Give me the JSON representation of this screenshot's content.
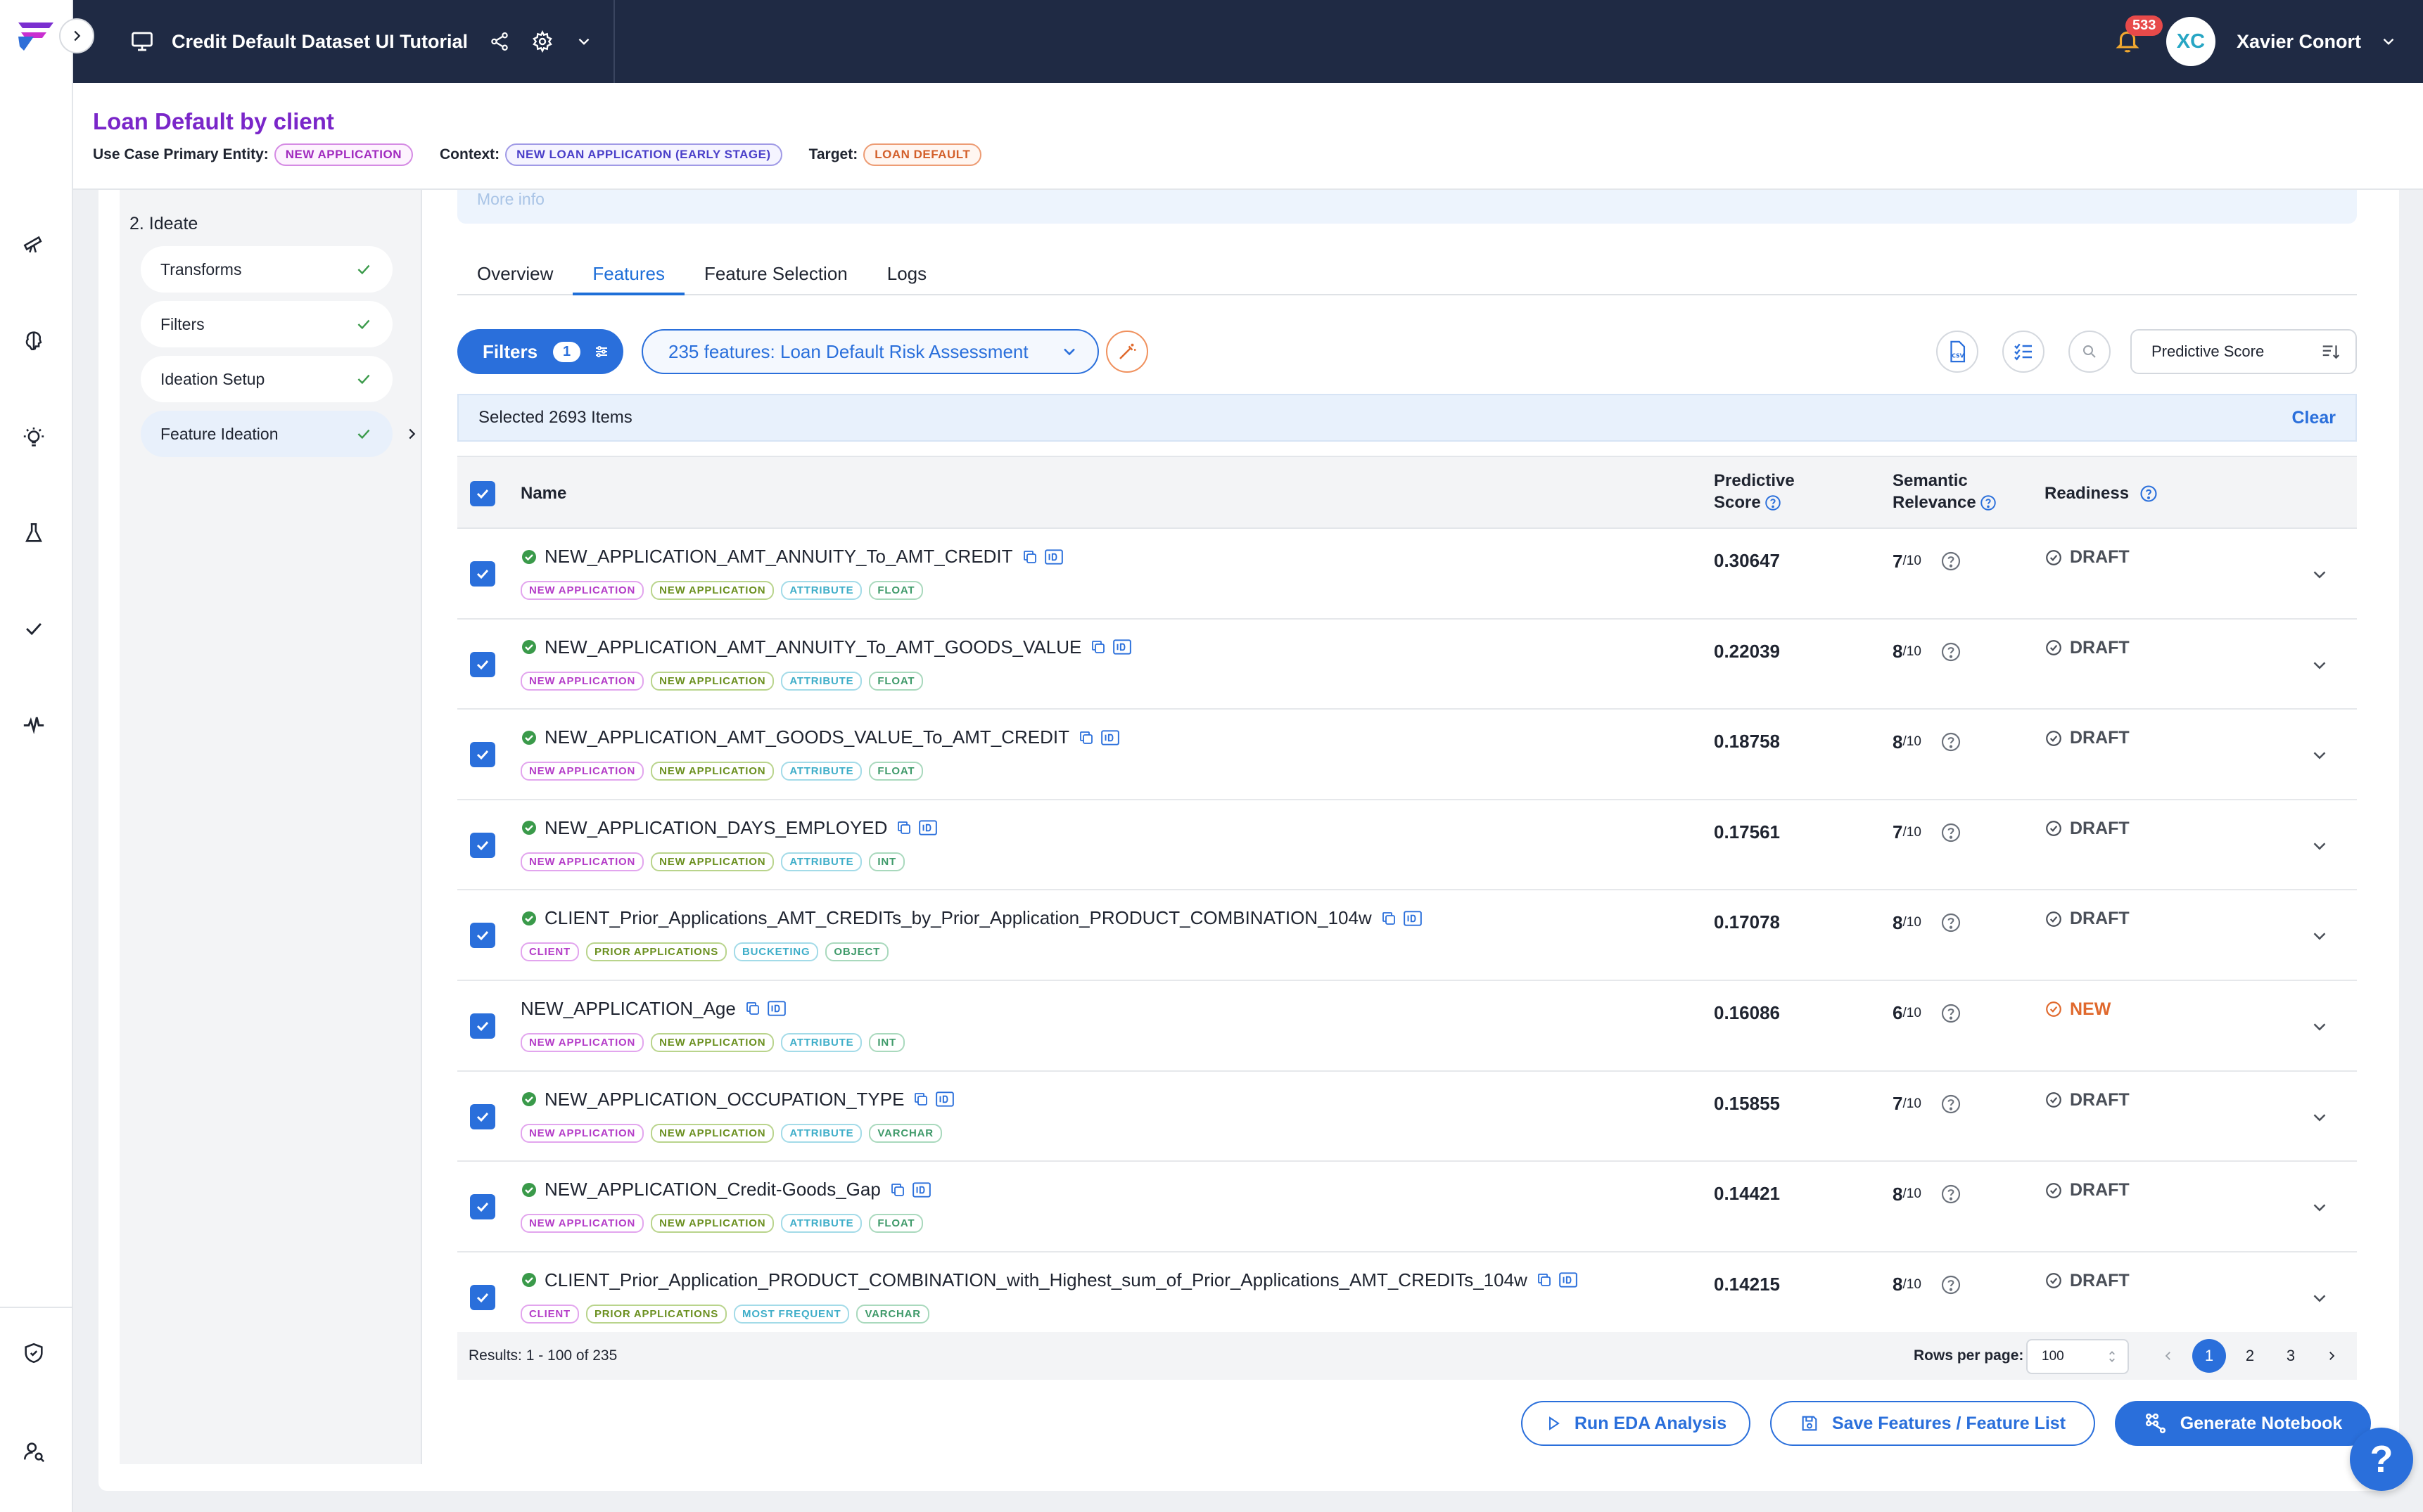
{
  "app": {
    "project_title": "Credit Default Dataset UI Tutorial",
    "notifications_count": "533",
    "user_initials": "XC",
    "user_name": "Xavier Conort"
  },
  "use_case": {
    "title": "Loan Default by client",
    "primary_entity_label": "Use Case Primary Entity:",
    "primary_entity": "NEW APPLICATION",
    "context_label": "Context:",
    "context": "NEW LOAN APPLICATION (EARLY STAGE)",
    "target_label": "Target:",
    "target": "LOAN DEFAULT"
  },
  "sidebar": {
    "section_title": "2. Ideate",
    "steps": [
      {
        "label": "Transforms"
      },
      {
        "label": "Filters"
      },
      {
        "label": "Ideation Setup"
      },
      {
        "label": "Feature Ideation"
      }
    ]
  },
  "banner": {
    "text": "More info"
  },
  "tabs": [
    {
      "label": "Overview"
    },
    {
      "label": "Features"
    },
    {
      "label": "Feature Selection"
    },
    {
      "label": "Logs"
    }
  ],
  "toolbar": {
    "filters_label": "Filters",
    "filters_count": "1",
    "features_selector": "235 features: Loan Default Risk Assessment",
    "sort_by": "Predictive Score"
  },
  "selection": {
    "text": "Selected 2693 Items",
    "clear_label": "Clear"
  },
  "table": {
    "headers": {
      "name": "Name",
      "predictive_score_line1": "Predictive",
      "predictive_score_line2": "Score",
      "semantic_relevance_line1": "Semantic",
      "semantic_relevance_line2": "Relevance",
      "readiness": "Readiness"
    },
    "rows": [
      {
        "name": "NEW_APPLICATION_AMT_ANNUITY_To_AMT_CREDIT",
        "tags": [
          "NEW APPLICATION",
          "NEW APPLICATION",
          "ATTRIBUTE",
          "FLOAT"
        ],
        "score": "0.30647",
        "relevance": "7",
        "relevance_suffix": "/10",
        "readiness": "DRAFT"
      },
      {
        "name": "NEW_APPLICATION_AMT_ANNUITY_To_AMT_GOODS_VALUE",
        "tags": [
          "NEW APPLICATION",
          "NEW APPLICATION",
          "ATTRIBUTE",
          "FLOAT"
        ],
        "score": "0.22039",
        "relevance": "8",
        "relevance_suffix": "/10",
        "readiness": "DRAFT"
      },
      {
        "name": "NEW_APPLICATION_AMT_GOODS_VALUE_To_AMT_CREDIT",
        "tags": [
          "NEW APPLICATION",
          "NEW APPLICATION",
          "ATTRIBUTE",
          "FLOAT"
        ],
        "score": "0.18758",
        "relevance": "8",
        "relevance_suffix": "/10",
        "readiness": "DRAFT"
      },
      {
        "name": "NEW_APPLICATION_DAYS_EMPLOYED",
        "tags": [
          "NEW APPLICATION",
          "NEW APPLICATION",
          "ATTRIBUTE",
          "INT"
        ],
        "score": "0.17561",
        "relevance": "7",
        "relevance_suffix": "/10",
        "readiness": "DRAFT"
      },
      {
        "name": "CLIENT_Prior_Applications_AMT_CREDITs_by_Prior_Application_PRODUCT_COMBINATION_104w",
        "tags": [
          "CLIENT",
          "PRIOR APPLICATIONS",
          "BUCKETING",
          "OBJECT"
        ],
        "score": "0.17078",
        "relevance": "8",
        "relevance_suffix": "/10",
        "readiness": "DRAFT"
      },
      {
        "name": "NEW_APPLICATION_Age",
        "tags": [
          "NEW APPLICATION",
          "NEW APPLICATION",
          "ATTRIBUTE",
          "INT"
        ],
        "score": "0.16086",
        "relevance": "6",
        "relevance_suffix": "/10",
        "readiness": "NEW"
      },
      {
        "name": "NEW_APPLICATION_OCCUPATION_TYPE",
        "tags": [
          "NEW APPLICATION",
          "NEW APPLICATION",
          "ATTRIBUTE",
          "VARCHAR"
        ],
        "score": "0.15855",
        "relevance": "7",
        "relevance_suffix": "/10",
        "readiness": "DRAFT"
      },
      {
        "name": "NEW_APPLICATION_Credit-Goods_Gap",
        "tags": [
          "NEW APPLICATION",
          "NEW APPLICATION",
          "ATTRIBUTE",
          "FLOAT"
        ],
        "score": "0.14421",
        "relevance": "8",
        "relevance_suffix": "/10",
        "readiness": "DRAFT"
      },
      {
        "name": "CLIENT_Prior_Application_PRODUCT_COMBINATION_with_Highest_sum_of_Prior_Applications_AMT_CREDITs_104w",
        "tags": [
          "CLIENT",
          "PRIOR APPLICATIONS",
          "MOST FREQUENT",
          "VARCHAR"
        ],
        "score": "0.14215",
        "relevance": "8",
        "relevance_suffix": "/10",
        "readiness": "DRAFT"
      }
    ]
  },
  "pagination": {
    "results": "Results: 1 - 100 of 235",
    "rows_per_page_label": "Rows per page:",
    "rows_per_page": "100",
    "pages": [
      "1",
      "2",
      "3"
    ]
  },
  "actions": {
    "run_eda": "Run EDA Analysis",
    "save_features": "Save Features / Feature List",
    "generate_notebook": "Generate Notebook"
  },
  "help_label": "?",
  "colors": {
    "primary": "#2a6fdb",
    "topbar": "#1f2a44",
    "title_purple": "#7a26c9",
    "new_status": "#e0692d",
    "check_green": "#3a9a4a"
  }
}
